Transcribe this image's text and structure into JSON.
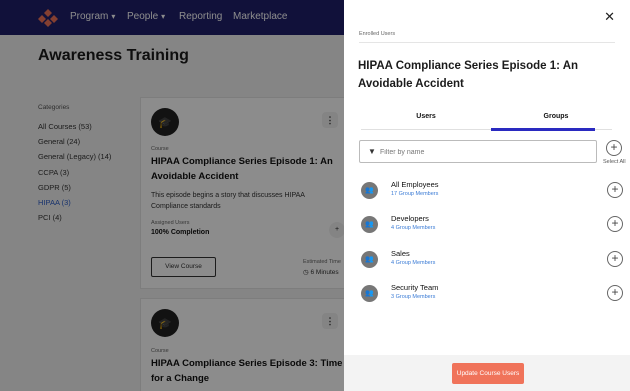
{
  "nav": {
    "items": [
      {
        "label": "Program",
        "has_chevron": true
      },
      {
        "label": "People",
        "has_chevron": true
      },
      {
        "label": "Reporting",
        "has_chevron": false
      },
      {
        "label": "Marketplace",
        "has_chevron": false
      }
    ]
  },
  "page": {
    "title": "Awareness Training",
    "categories_heading": "Categories",
    "categories": [
      "All Courses (53)",
      "General (24)",
      "General (Legacy) (14)",
      "CCPA (3)",
      "GDPR (5)",
      "HIPAA (3)",
      "PCI (4)"
    ],
    "active_category": "HIPAA (3)"
  },
  "cards": [
    {
      "type_label": "Course",
      "title": "HIPAA Compliance Series Episode 1: An Avoidable Accident",
      "description": "This episode begins a story that discusses HIPAA Compliance standards",
      "assigned_label": "Assigned Users",
      "completion": "100% Completion",
      "view_label": "View Course",
      "estimated_label": "Estimated Time",
      "estimated_value": "6 Minutes"
    },
    {
      "type_label": "Course",
      "title": "HIPAA Compliance Series Episode 3: Time for a Change"
    }
  ],
  "drawer": {
    "subtitle": "Enrolled Users",
    "title": "HIPAA Compliance Series Episode 1: An Avoidable Accident",
    "tabs": [
      "Users",
      "Groups"
    ],
    "active_tab": "Groups",
    "filter_placeholder": "Filter by name",
    "select_all_label": "Select All",
    "groups": [
      {
        "name": "All Employees",
        "count": "17 Group Members"
      },
      {
        "name": "Developers",
        "count": "4 Group Members"
      },
      {
        "name": "Sales",
        "count": "4 Group Members"
      },
      {
        "name": "Security Team",
        "count": "3 Group Members"
      }
    ],
    "update_label": "Update Course Users"
  },
  "colors": {
    "nav_bg": "#1f1f6b",
    "accent": "#2a2ac0",
    "link": "#3a7bd5",
    "update_button": "#f0735a"
  }
}
